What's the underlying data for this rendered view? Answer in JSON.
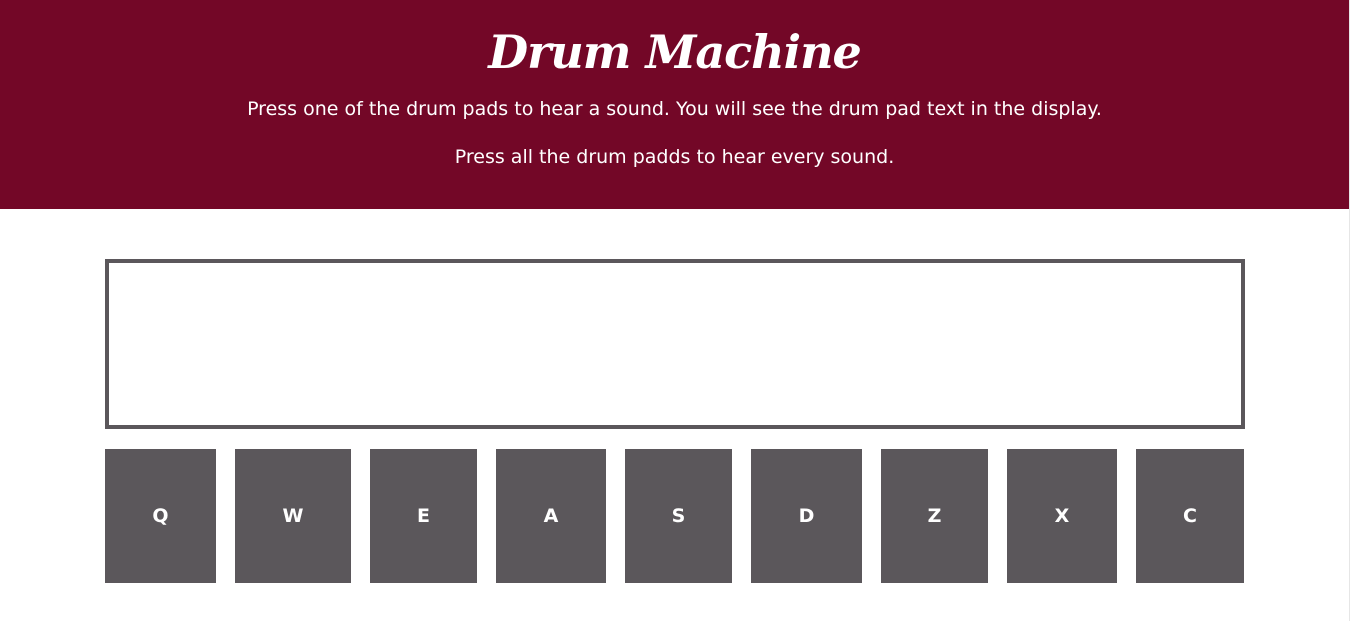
{
  "header": {
    "title": "Drum Machine",
    "subtitle_1": "Press one of the drum pads to hear a sound. You will see the drum pad text in the display.",
    "subtitle_2": "Press all the drum padds to hear every sound."
  },
  "display": {
    "text": ""
  },
  "pads": [
    "Q",
    "W",
    "E",
    "A",
    "S",
    "D",
    "Z",
    "X",
    "C"
  ],
  "colors": {
    "header_bg": "#730727",
    "pad_bg": "#5b575b",
    "display_border": "#5b575b",
    "text_light": "#ffffff"
  }
}
